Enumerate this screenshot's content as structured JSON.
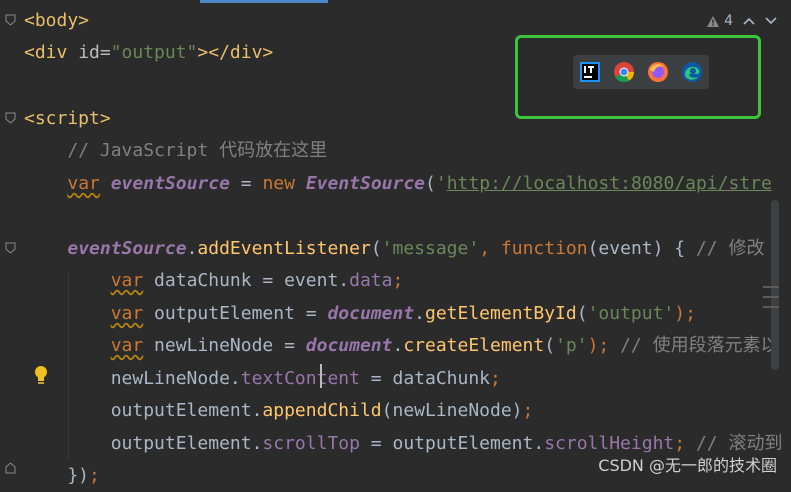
{
  "editor": {
    "lines": [
      {
        "id": "l1",
        "parts": [
          {
            "t": "<body>",
            "c": "tag"
          }
        ]
      },
      {
        "id": "l2",
        "parts": [
          {
            "t": "<div ",
            "c": "tag"
          },
          {
            "t": "id=",
            "c": "attr"
          },
          {
            "t": "\"output\"",
            "c": "str"
          },
          {
            "t": "></div>",
            "c": "tag"
          }
        ]
      },
      {
        "id": "l3",
        "parts": [
          {
            "t": "<script>",
            "c": "tag"
          }
        ]
      },
      {
        "id": "l4",
        "parts": [
          {
            "t": "    // JavaScript 代码放在这里",
            "c": "comment"
          }
        ]
      },
      {
        "id": "l5",
        "parts": [
          {
            "t": "    ",
            "c": "plain"
          },
          {
            "t": "var",
            "c": "kw squiggle"
          },
          {
            "t": " ",
            "c": "plain"
          },
          {
            "t": "eventSource",
            "c": "fn-italic"
          },
          {
            "t": " = ",
            "c": "plain"
          },
          {
            "t": "new ",
            "c": "kw"
          },
          {
            "t": "EventSource",
            "c": "fn-italic"
          },
          {
            "t": "(",
            "c": "plain"
          },
          {
            "t": "'",
            "c": "str"
          },
          {
            "t": "http://localhost:8080/api/stre",
            "c": "url"
          }
        ]
      },
      {
        "id": "l6",
        "parts": [
          {
            "t": "    ",
            "c": "plain"
          },
          {
            "t": "eventSource",
            "c": "fn-italic"
          },
          {
            "t": ".",
            "c": "plain"
          },
          {
            "t": "addEventListener",
            "c": "method"
          },
          {
            "t": "(",
            "c": "plain"
          },
          {
            "t": "'message'",
            "c": "str"
          },
          {
            "t": ", ",
            "c": "kw"
          },
          {
            "t": "function",
            "c": "kw"
          },
          {
            "t": "(event) { ",
            "c": "plain"
          },
          {
            "t": "// 修改",
            "c": "comment"
          }
        ]
      },
      {
        "id": "l7",
        "parts": [
          {
            "t": "        ",
            "c": "plain"
          },
          {
            "t": "var",
            "c": "kw squiggle"
          },
          {
            "t": " dataChunk = event.",
            "c": "plain"
          },
          {
            "t": "data",
            "c": "prop"
          },
          {
            "t": ";",
            "c": "kw"
          }
        ]
      },
      {
        "id": "l8",
        "parts": [
          {
            "t": "        ",
            "c": "plain"
          },
          {
            "t": "var",
            "c": "kw squiggle"
          },
          {
            "t": " outputElement = ",
            "c": "plain"
          },
          {
            "t": "document",
            "c": "fn-italic"
          },
          {
            "t": ".",
            "c": "plain"
          },
          {
            "t": "getElementById",
            "c": "method"
          },
          {
            "t": "(",
            "c": "plain"
          },
          {
            "t": "'output'",
            "c": "str"
          },
          {
            "t": ");",
            "c": "kw"
          }
        ]
      },
      {
        "id": "l9",
        "parts": [
          {
            "t": "        ",
            "c": "plain"
          },
          {
            "t": "var",
            "c": "kw squiggle"
          },
          {
            "t": " newLineNode = ",
            "c": "plain"
          },
          {
            "t": "document",
            "c": "fn-italic"
          },
          {
            "t": ".",
            "c": "plain"
          },
          {
            "t": "createElement",
            "c": "method"
          },
          {
            "t": "(",
            "c": "plain"
          },
          {
            "t": "'p'",
            "c": "str"
          },
          {
            "t": "); ",
            "c": "kw"
          },
          {
            "t": "// 使用段落元素以",
            "c": "comment"
          }
        ]
      },
      {
        "id": "l10",
        "parts": [
          {
            "t": "        newLineNode.",
            "c": "plain"
          },
          {
            "t": "textContent",
            "c": "prop"
          },
          {
            "t": " = dataChunk",
            "c": "plain"
          },
          {
            "t": ";",
            "c": "kw"
          }
        ]
      },
      {
        "id": "l11",
        "parts": [
          {
            "t": "        outputElement.",
            "c": "plain"
          },
          {
            "t": "appendChild",
            "c": "method"
          },
          {
            "t": "(newLineNode)",
            "c": "plain"
          },
          {
            "t": ";",
            "c": "kw"
          }
        ]
      },
      {
        "id": "l12",
        "parts": [
          {
            "t": "        outputElement.",
            "c": "plain"
          },
          {
            "t": "scrollTop",
            "c": "prop"
          },
          {
            "t": " = outputElement.",
            "c": "plain"
          },
          {
            "t": "scrollHeight",
            "c": "prop"
          },
          {
            "t": "; ",
            "c": "kw"
          },
          {
            "t": "// 滚动到",
            "c": "comment"
          }
        ]
      },
      {
        "id": "l13",
        "parts": [
          {
            "t": "    })",
            "c": "plain"
          },
          {
            "t": ";",
            "c": "kw"
          }
        ]
      }
    ]
  },
  "hint_bar": {
    "warning_count": "4"
  },
  "browser_popup": {
    "icons": [
      "intellij-icon",
      "chrome-icon",
      "firefox-icon",
      "edge-icon"
    ]
  },
  "watermark": "CSDN @无一郎的技术圈",
  "colors": {
    "highlight_box": "#3cc43c",
    "editor_bg": "#2b2b2b"
  }
}
